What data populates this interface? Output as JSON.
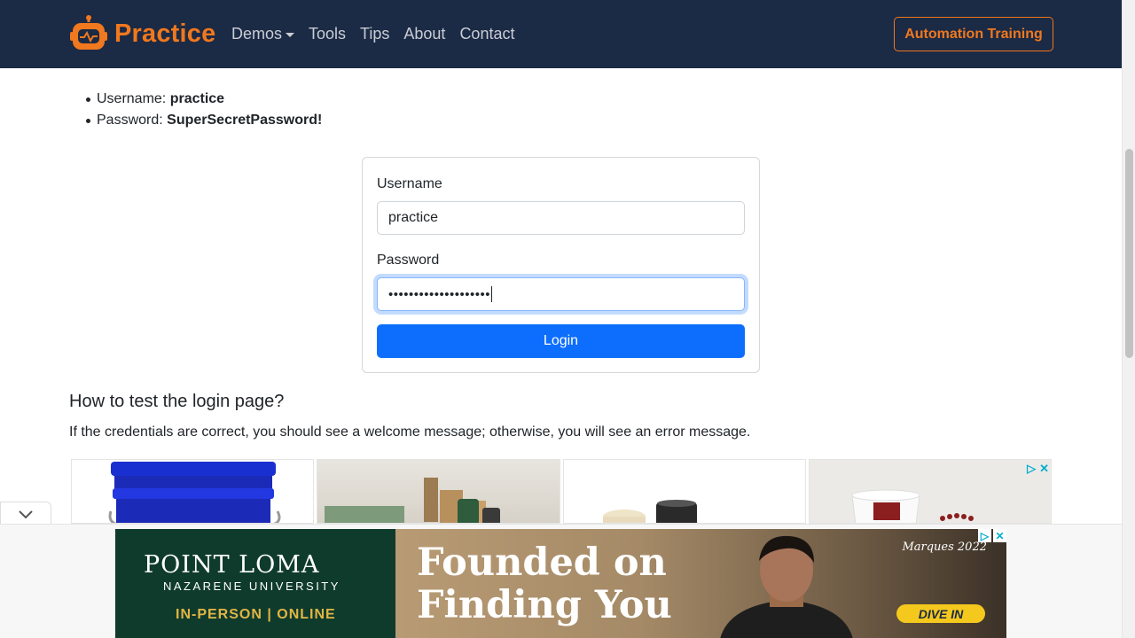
{
  "navbar": {
    "brand": "Practice",
    "links": [
      {
        "label": "Demos",
        "dropdown": true
      },
      {
        "label": "Tools"
      },
      {
        "label": "Tips"
      },
      {
        "label": "About"
      },
      {
        "label": "Contact"
      }
    ],
    "cta": "Automation Training",
    "brand_color": "#f0781e",
    "bg_color": "#1b2a45"
  },
  "credentials": {
    "username_label": "Username:",
    "username_value": "practice",
    "password_label": "Password:",
    "password_value": "SuperSecretPassword!"
  },
  "form": {
    "username_label": "Username",
    "username_value": "practice",
    "password_label": "Password",
    "password_masked": "••••••••••••••••••••",
    "submit": "Login",
    "submit_color": "#0d6efd"
  },
  "section": {
    "title": "How to test the login page?",
    "text": "If the credentials are correct, you should see a welcome message; otherwise, you will see an error message."
  },
  "ads": {
    "banner": {
      "school": "POINT LOMA",
      "school_sub": "NAZARENE UNIVERSITY",
      "modes": "IN-PERSON | ONLINE",
      "headline_1": "Founded on",
      "headline_2": "Finding You",
      "tag": "Marques 2022",
      "cta": "DIVE IN"
    }
  }
}
